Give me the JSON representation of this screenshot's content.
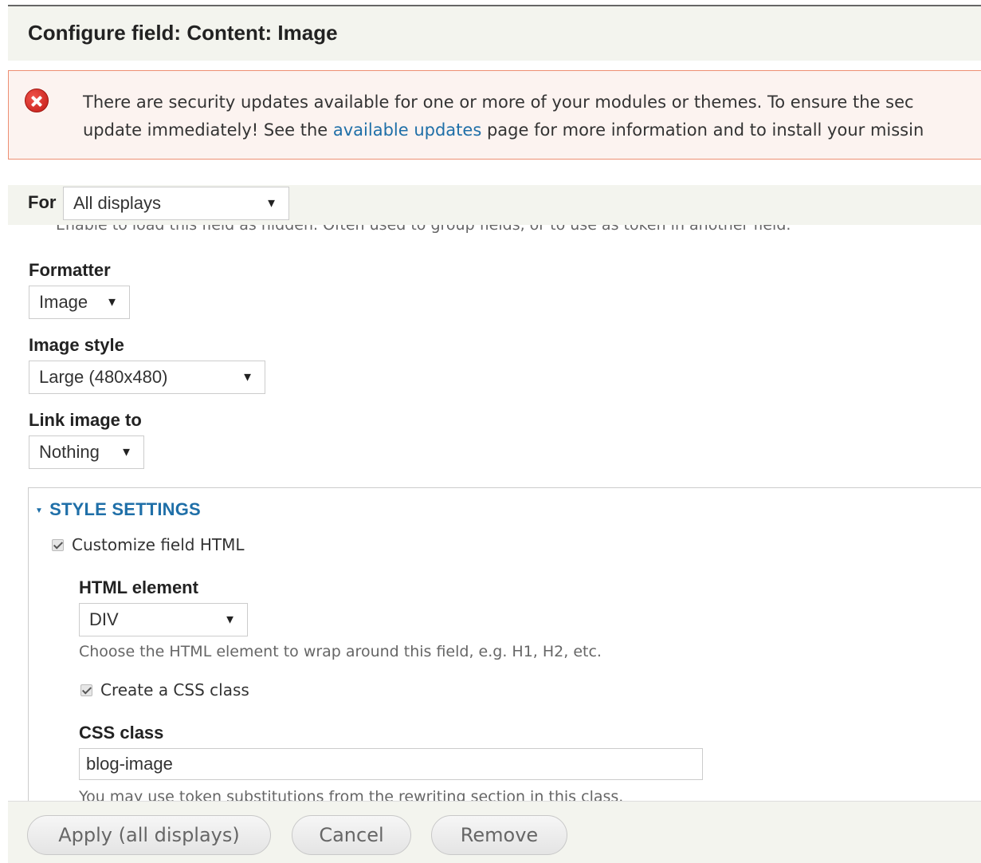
{
  "title": "Configure field: Content: Image",
  "alert": {
    "line1": "There are security updates available for one or more of your modules or themes. To ensure the sec",
    "line2_before": "update immediately! See the ",
    "link": "available updates",
    "line2_after": " page for more information and to install your missin",
    "icon": "error-icon",
    "border_color": "#ed8f73",
    "background_color": "#fcf3f0"
  },
  "for_bar": {
    "label": "For",
    "selected": "All displays"
  },
  "hidden_help": "Enable to load this field as hidden. Often used to group fields, or to use as token in another field.",
  "formatter": {
    "label": "Formatter",
    "selected": "Image"
  },
  "image_style": {
    "label": "Image style",
    "selected": "Large (480x480)"
  },
  "link_image": {
    "label": "Link image to",
    "selected": "Nothing"
  },
  "style_settings": {
    "legend": "STYLE SETTINGS",
    "customize_label": "Customize field HTML",
    "customize_checked": true,
    "html_element": {
      "label": "HTML element",
      "selected": "DIV",
      "description": "Choose the HTML element to wrap around this field, e.g. H1, H2, etc."
    },
    "css_class_checkbox": {
      "label": "Create a CSS class",
      "checked": true
    },
    "css_class": {
      "label": "CSS class",
      "value": "blog-image",
      "description": "You may use token substitutions from the rewriting section in this class."
    }
  },
  "buttons": {
    "apply": "Apply (all displays)",
    "cancel": "Cancel",
    "remove": "Remove"
  },
  "colors": {
    "link": "#1f6fa8",
    "header_bg": "#f3f4ee"
  }
}
